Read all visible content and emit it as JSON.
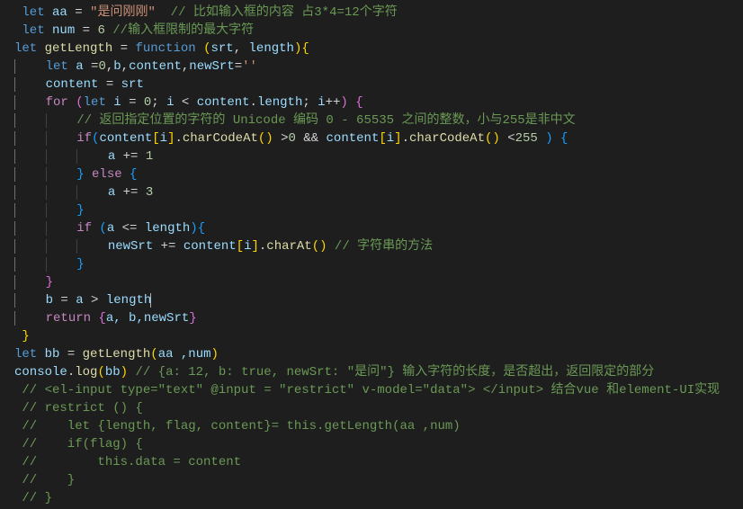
{
  "lines": {
    "l1": {
      "kw": "let",
      "v": "aa",
      "eq": " = ",
      "str": "\"是问刚刚\"",
      "cmt": "  // 比如输入框的内容 占3*4=12个字符"
    },
    "l2": {
      "kw": "let",
      "v": "num",
      "eq": " = ",
      "num": "6",
      "cmt": " //输入框限制的最大字符"
    },
    "l3": {
      "kw": "let",
      "v": "getLength",
      "eq": " = ",
      "fn_kw": "function",
      "args": "(srt, length)",
      "brace": "{"
    },
    "l4": {
      "kw": "let",
      "rest": " a =0,b,content,newSrt=''"
    },
    "l5": {
      "v": "content",
      "eq": " = ",
      "rhs": "srt"
    },
    "l6": {
      "kw": "for",
      "open": " (",
      "let": "let",
      "i": " i",
      "eq": " = ",
      "z": "0",
      "semi1": ";",
      "cond": " i < content.length",
      "semi2": ";",
      "inc": " i++",
      "close": ") ",
      "brace": "{"
    },
    "l7": {
      "cmt": "// 返回指定位置的字符的 Unicode 编码 0 - 65535 之间的整数，小与255是非中文"
    },
    "l8": {
      "if": "if",
      "open": "(",
      "part1": "content",
      "b1": "[",
      "i": "i",
      "b2": "]",
      "dot": ".",
      "fn": "charCodeAt",
      "p1": "()",
      "op1": " >",
      "n0": "0",
      "and": " && ",
      "part2": "content",
      "b3": "[",
      "i2": "i",
      "b4": "]",
      "dot2": ".",
      "fn2": "charCodeAt",
      "p2": "()",
      "op2": " <",
      "n255": "255",
      "close": " )",
      "brace": " {"
    },
    "l9": {
      "v": "a",
      "op": " += ",
      "num": "1"
    },
    "l10": {
      "brace_close": "}",
      "else": " else ",
      "brace_open": "{"
    },
    "l11": {
      "v": "a",
      "op": " += ",
      "num": "3"
    },
    "l12": {
      "brace": "}"
    },
    "l13": {
      "if": "if",
      "open": " (",
      "cond": "a <= length",
      "close": ")",
      "brace": "{"
    },
    "l14": {
      "v": "newSrt",
      "op": " += ",
      "obj": "content",
      "b1": "[",
      "i": "i",
      "b2": "]",
      "dot": ".",
      "fn": "charAt",
      "p": "()",
      "cmt": " // 字符串的方法"
    },
    "l15": {
      "brace": "}"
    },
    "l16": {
      "brace": "}"
    },
    "l17": {
      "v": "b",
      "eq": " = ",
      "rhs": "a > length"
    },
    "l18": {
      "ret": "return",
      "open": " {",
      "vals": "a, b,newSrt",
      "close": "}"
    },
    "l19": {
      "brace": "}"
    },
    "l20": {
      "kw": "let",
      "v": "bb",
      "eq": " = ",
      "fn": "getLength",
      "open": "(",
      "args": "aa ,num",
      "close": ")"
    },
    "l21": {
      "obj": "console",
      "dot": ".",
      "fn": "log",
      "open": "(",
      "arg": "bb",
      "close": ")",
      "cmt": " // {a: 12, b: true, newSrt: \"是问\"} 输入字符的长度，是否超出，返回限定的部分"
    },
    "l22": {
      "cmt": " // <el-input type=\"text\" @input = \"restrict\" v-model=\"data\"> </input> 结合vue 和element-UI实现"
    },
    "l23": {
      "cmt": " // restrict () {"
    },
    "l24": {
      "cmt": " //    let {length, flag, content}= this.getLength(aa ,num)"
    },
    "l25": {
      "cmt": " //    if(flag) {"
    },
    "l26": {
      "cmt": " //        this.data = content"
    },
    "l27": {
      "cmt": " //    }"
    },
    "l28": {
      "cmt": " // }"
    }
  }
}
